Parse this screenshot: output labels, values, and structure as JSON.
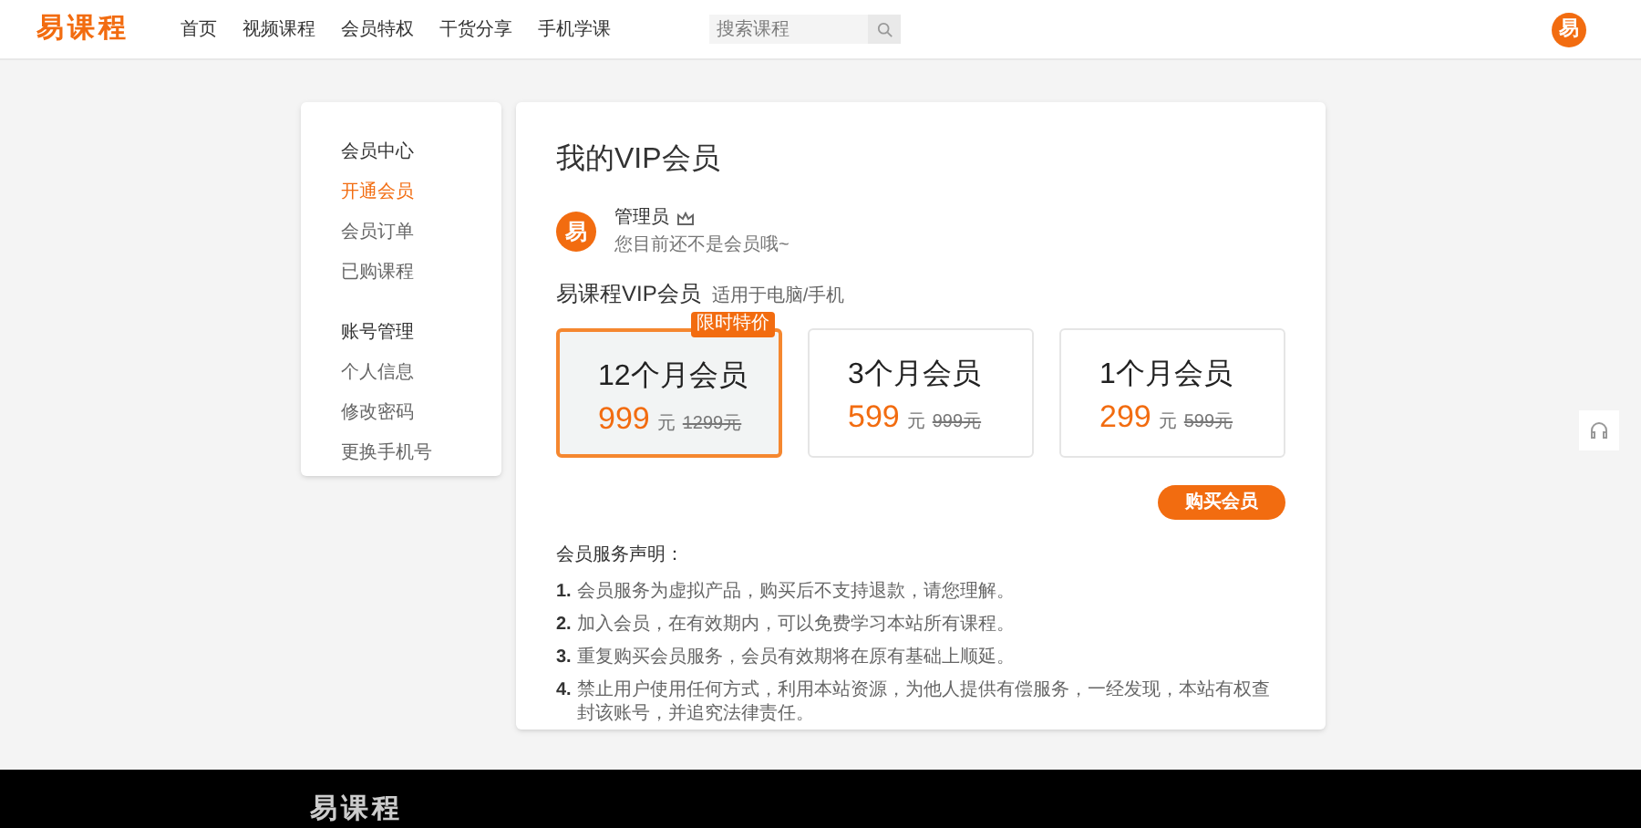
{
  "header": {
    "logo": "易课程",
    "nav": [
      {
        "label": "首页",
        "selected": false
      },
      {
        "label": "视频课程",
        "selected": false
      },
      {
        "label": "会员特权",
        "selected": false
      },
      {
        "label": "干货分享",
        "selected": false
      },
      {
        "label": "手机学课",
        "selected": false
      }
    ],
    "search": {
      "placeholder": "搜索课程"
    },
    "avatar": "易"
  },
  "sidebar": {
    "groups": [
      {
        "title": "会员中心",
        "items": [
          {
            "label": "开通会员",
            "selected": true
          },
          {
            "label": "会员订单",
            "selected": false
          },
          {
            "label": "已购课程",
            "selected": false
          }
        ]
      },
      {
        "title": "账号管理",
        "items": [
          {
            "label": "个人信息",
            "selected": false
          },
          {
            "label": "修改密码",
            "selected": false
          },
          {
            "label": "更换手机号",
            "selected": false
          }
        ]
      }
    ]
  },
  "main": {
    "title": "我的VIP会员",
    "user": {
      "avatar": "易",
      "name": "管理员",
      "note": "您目前还不是会员哦~"
    },
    "section_title": "易课程VIP会员",
    "section_note": "适用于电脑/手机",
    "plans": [
      {
        "name": "12个月会员",
        "price": "999",
        "unit": "元",
        "old_price": "1299元",
        "badge": "限时特价",
        "selected": true
      },
      {
        "name": "3个月会员",
        "price": "599",
        "unit": "元",
        "old_price": "999元",
        "selected": false
      },
      {
        "name": "1个月会员",
        "price": "299",
        "unit": "元",
        "old_price": "599元",
        "selected": false
      }
    ],
    "buy_button": "购买会员",
    "terms_title": "会员服务声明：",
    "terms": [
      {
        "num": "1.",
        "text": "会员服务为虚拟产品，购买后不支持退款，请您理解。"
      },
      {
        "num": "2.",
        "text": "加入会员，在有效期内，可以免费学习本站所有课程。"
      },
      {
        "num": "3.",
        "text": "重复购买会员服务，会员有效期将在原有基础上顺延。"
      },
      {
        "num": "4.",
        "text": "禁止用户使用任何方式，利用本站资源，为他人提供有偿服务，一经发现，本站有权查封该账号，并追究法律责任。"
      }
    ]
  },
  "footer": {
    "logo": "易课程"
  }
}
